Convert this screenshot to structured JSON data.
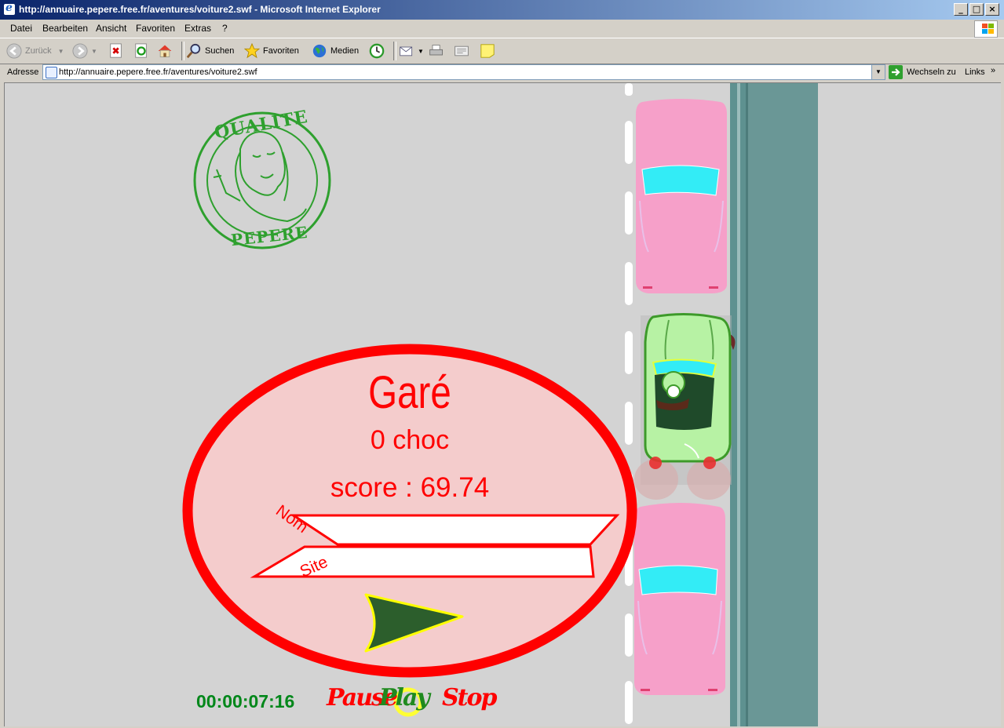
{
  "window": {
    "title": "http://annuaire.pepere.free.fr/aventures/voiture2.swf - Microsoft Internet Explorer",
    "buttons": [
      "minimize",
      "maximize",
      "close"
    ]
  },
  "menu": {
    "items": [
      "Datei",
      "Bearbeiten",
      "Ansicht",
      "Favoriten",
      "Extras",
      "?"
    ]
  },
  "toolbar": {
    "back_label": "Zurück",
    "search_label": "Suchen",
    "favorites_label": "Favoriten",
    "media_label": "Medien"
  },
  "address": {
    "label": "Adresse",
    "url": "http://annuaire.pepere.free.fr/aventures/voiture2.swf",
    "go_label": "Wechseln zu",
    "links_label": "Links"
  },
  "game": {
    "stamp_top_text": "QUALITE",
    "stamp_bottom_text": "PEPERE",
    "result": {
      "status": "Garé",
      "collisions": "0 choc",
      "score": "score : 69.74",
      "name_label": "Nom",
      "site_label": "Site",
      "name_value": "",
      "site_value": ""
    },
    "timer": "00:00:07:16",
    "controls": {
      "pause": "Pause",
      "play": "Play",
      "stop": "Stop"
    },
    "colors": {
      "background": "#d3d3d3",
      "sidewalk": "#6a9796",
      "panel_fill": "#f4cccc",
      "panel_border": "#ff0000",
      "parked_car": "#f6a0c9",
      "player_car": "#b7f2a4",
      "timer": "#00871a"
    }
  }
}
